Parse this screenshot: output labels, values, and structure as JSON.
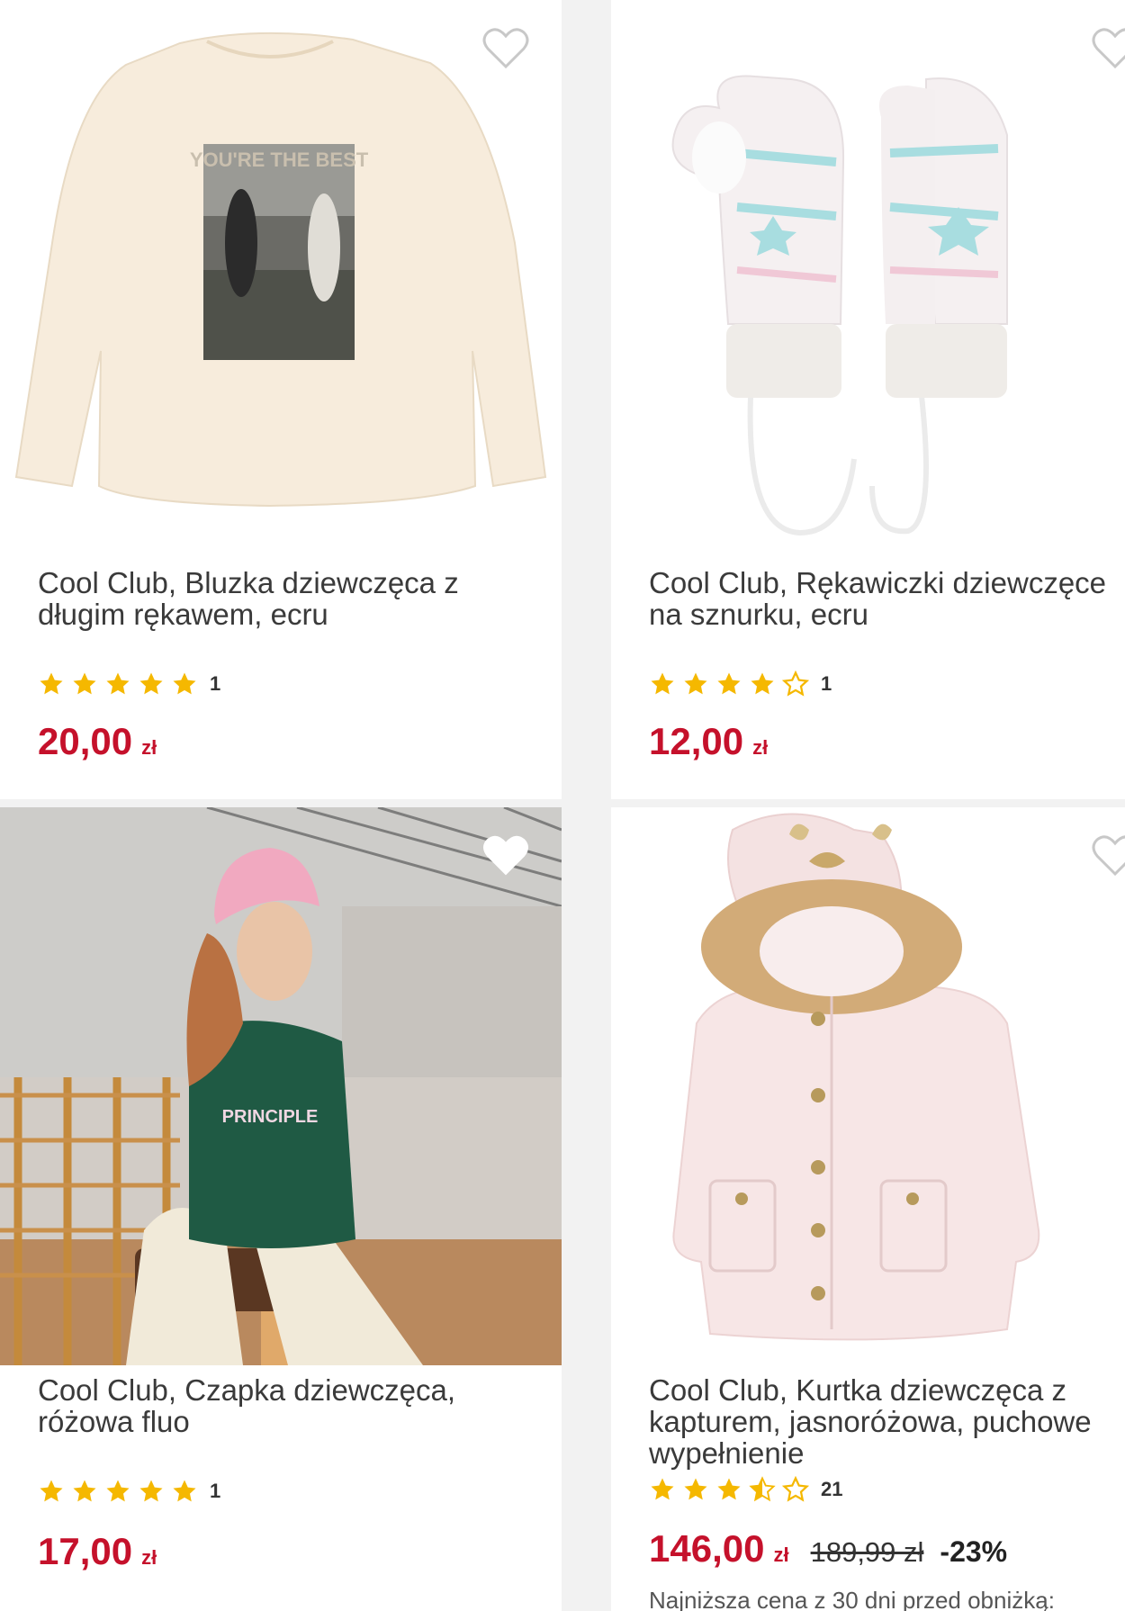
{
  "products": [
    {
      "title": "Cool Club, Bluzka dziewczęca z długim rękawem, ecru",
      "print_text": "YOU'RE THE BEST",
      "rating_stars": 5,
      "rating_count": "1",
      "price": "20,00",
      "currency": "zł"
    },
    {
      "title": "Cool Club, Rękawiczki dziewczęce na sznurku, ecru",
      "rating_stars": 4,
      "rating_count": "1",
      "price": "12,00",
      "currency": "zł"
    },
    {
      "title": "Cool Club, Czapka dziewczęca, różowa fluo",
      "sweatshirt_text": "PRINCIPLE",
      "rating_stars": 5,
      "rating_count": "1",
      "price": "17,00",
      "currency": "zł"
    },
    {
      "title": "Cool Club, Kurtka dziewczęca z kapturem, jasnoróżowa, puchowe wypełnienie",
      "rating_stars": 3.5,
      "rating_count": "21",
      "price": "146,00",
      "currency": "zł",
      "old_price": "189,99 zł",
      "discount": "-23%",
      "lowest_price_note": "Najniższa cena z 30 dni przed obniżką:"
    }
  ],
  "icons": {
    "favorite": "heart-outline-icon",
    "rating": "star-icon"
  },
  "colors": {
    "price": "#c5112b",
    "star": "#f5b800",
    "background": "#f2f2f2"
  }
}
